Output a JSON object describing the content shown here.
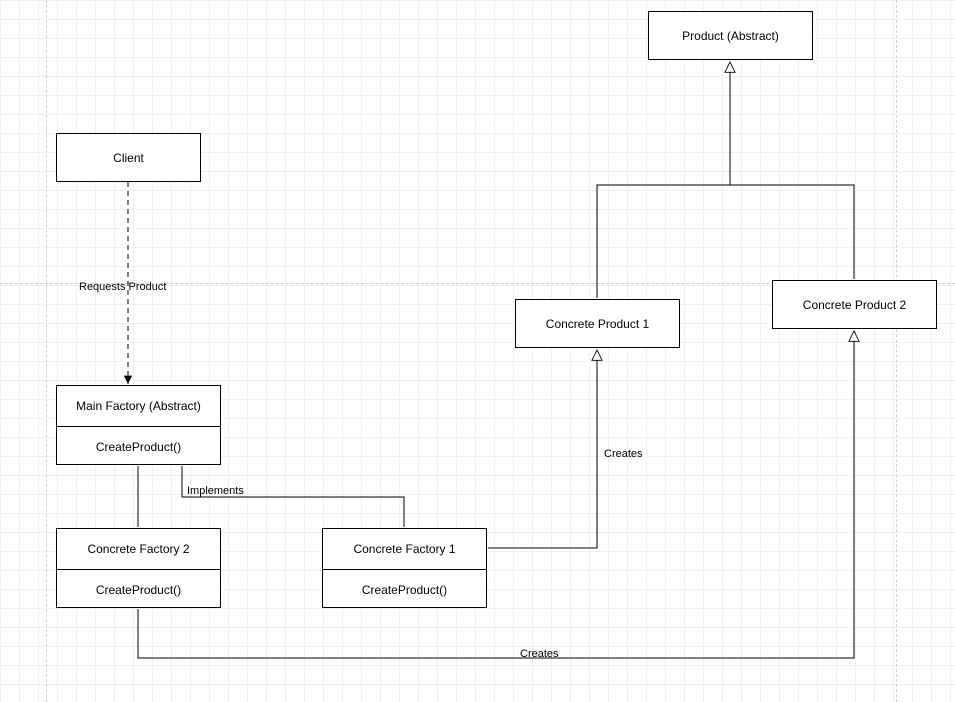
{
  "nodes": {
    "client": {
      "label": "Client"
    },
    "mainFactory": {
      "title": "Main Factory (Abstract)",
      "method": "CreateProduct()"
    },
    "concreteFactory1": {
      "title": "Concrete Factory 1",
      "method": "CreateProduct()"
    },
    "concreteFactory2": {
      "title": "Concrete Factory 2",
      "method": "CreateProduct()"
    },
    "productAbstract": {
      "label": "Product (Abstract)"
    },
    "concreteProduct1": {
      "label": "Concrete Product 1"
    },
    "concreteProduct2": {
      "label": "Concrete Product 2"
    }
  },
  "edges": {
    "requestsProduct": {
      "label": "Requests Product"
    },
    "implements": {
      "label": "Implements"
    },
    "creates1": {
      "label": "Creates"
    },
    "creates2": {
      "label": "Creates"
    }
  }
}
